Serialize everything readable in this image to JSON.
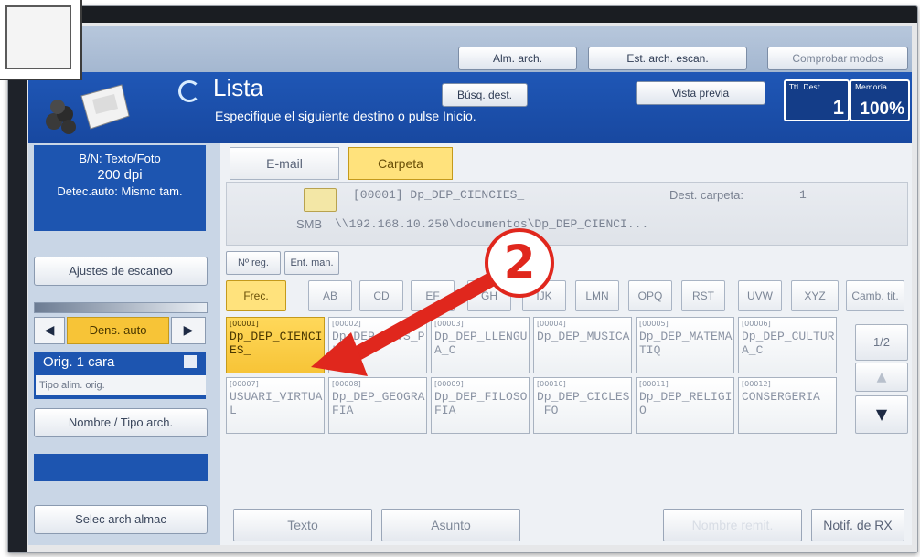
{
  "top_bar": {
    "alm_arch": "Alm. arch.",
    "est_arch": "Est. arch. escan.",
    "comprobar": "Comprobar modos"
  },
  "header": {
    "title": "Lista",
    "subtitle": "Especifique el siguiente destino o pulse Inicio.",
    "busq_dest": "Búsq. dest.",
    "vista_previa": "Vista previa",
    "tot_dest_label": "Ttl. Dest.",
    "tot_dest_value": "1",
    "memoria_label": "Memoria",
    "memoria_value": "100%"
  },
  "left": {
    "mode_line1": "B/N: Texto/Foto",
    "mode_line2": "200 dpi",
    "mode_line3": "Detec.auto: Mismo tam.",
    "ajustes": "Ajustes de escaneo",
    "dens": "Dens. auto",
    "orig": "Orig. 1 cara",
    "tipo_alim": "Tipo alim. orig.",
    "nombre_tipo": "Nombre / Tipo arch.",
    "selec": "Selec arch almac"
  },
  "tabs": {
    "email": "E-mail",
    "carpeta": "Carpeta"
  },
  "dest": {
    "line1": "[00001] Dp_DEP_CIENCIES_",
    "dest_carpeta": "Dest. carpeta:",
    "dest_carpeta_val": "1",
    "smb": "SMB",
    "path": "\\\\192.168.10.250\\documentos\\Dp_DEP_CIENCI..."
  },
  "buttons": {
    "n_reg": "Nº reg.",
    "ent_man": "Ent. man."
  },
  "filters": [
    "Frec.",
    "AB",
    "CD",
    "EF",
    "GH",
    "IJK",
    "LMN",
    "OPQ",
    "RST",
    "UVW",
    "XYZ",
    "Camb. tit."
  ],
  "grid": [
    {
      "num": "[00001]",
      "name": "Dp_DEP_CIENCIES_",
      "selected": true
    },
    {
      "num": "[00002]",
      "name": "Dp_DEP_ARTS_PLAS",
      "selected": false
    },
    {
      "num": "[00003]",
      "name": "Dp_DEP_LLENGUA_C",
      "selected": false
    },
    {
      "num": "[00004]",
      "name": "Dp_DEP_MUSICA",
      "selected": false
    },
    {
      "num": "[00005]",
      "name": "Dp_DEP_MATEMATIQ",
      "selected": false
    },
    {
      "num": "[00006]",
      "name": "Dp_DEP_CULTURA_C",
      "selected": false
    },
    {
      "num": "[00007]",
      "name": "USUARI_VIRTUAL",
      "selected": false
    },
    {
      "num": "[00008]",
      "name": "Dp_DEP_GEOGRAFIA",
      "selected": false
    },
    {
      "num": "[00009]",
      "name": "Dp_DEP_FILOSOFIA",
      "selected": false
    },
    {
      "num": "[00010]",
      "name": "Dp_DEP_CICLES_FO",
      "selected": false
    },
    {
      "num": "[00011]",
      "name": "Dp_DEP_RELIGIO",
      "selected": false
    },
    {
      "num": "[00012]",
      "name": "CONSERGERIA",
      "selected": false
    }
  ],
  "pager": "1/2",
  "bottom": {
    "texto": "Texto",
    "asunto": "Asunto",
    "nombre_remit": "Nombre remit.",
    "notif": "Notif. de RX"
  },
  "annotation": {
    "step": "2"
  },
  "colors": {
    "accent_blue": "#1d55b0",
    "selected_yellow": "#f7c437",
    "arrow_red": "#e0271d"
  }
}
